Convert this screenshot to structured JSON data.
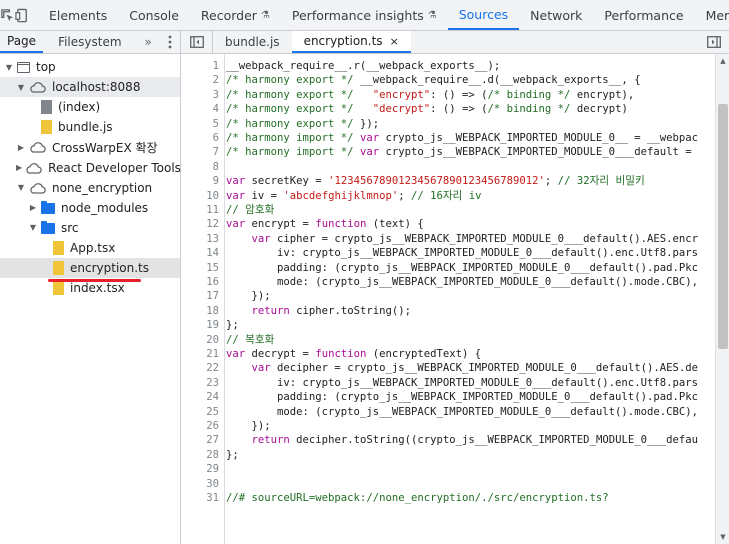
{
  "top_tabs": [
    {
      "label": "Elements",
      "active": false
    },
    {
      "label": "Console",
      "active": false
    },
    {
      "label": "Recorder",
      "active": false,
      "flask": true
    },
    {
      "label": "Performance insights",
      "active": false,
      "flask": true
    },
    {
      "label": "Sources",
      "active": true
    },
    {
      "label": "Network",
      "active": false
    },
    {
      "label": "Performance",
      "active": false
    },
    {
      "label": "Memor",
      "active": false
    }
  ],
  "navigator": {
    "tabs": [
      "Page",
      "Filesystem"
    ],
    "more": "»",
    "tree": [
      {
        "label": "top",
        "depth": 0,
        "icon": "frame",
        "twisty": "▼"
      },
      {
        "label": "localhost:8088",
        "depth": 1,
        "icon": "cloud",
        "twisty": "▼",
        "highlight": "light"
      },
      {
        "label": "(index)",
        "depth": 2,
        "icon": "file-gray",
        "twisty": ""
      },
      {
        "label": "bundle.js",
        "depth": 2,
        "icon": "file-yellow",
        "twisty": ""
      },
      {
        "label": "CrossWarpEX 확장",
        "depth": 1,
        "icon": "cloud",
        "twisty": "▶"
      },
      {
        "label": "React Developer Tools",
        "depth": 1,
        "icon": "cloud",
        "twisty": "▶"
      },
      {
        "label": "none_encryption",
        "depth": 1,
        "icon": "cloud",
        "twisty": "▼"
      },
      {
        "label": "node_modules",
        "depth": 2,
        "icon": "folder",
        "twisty": "▶"
      },
      {
        "label": "src",
        "depth": 2,
        "icon": "folder",
        "twisty": "▼"
      },
      {
        "label": "App.tsx",
        "depth": 3,
        "icon": "file-yellow",
        "twisty": ""
      },
      {
        "label": "encryption.ts",
        "depth": 3,
        "icon": "file-yellow",
        "twisty": "",
        "highlight": "hover"
      },
      {
        "label": "index.tsx",
        "depth": 3,
        "icon": "file-yellow",
        "twisty": ""
      }
    ]
  },
  "editor": {
    "tabs": [
      {
        "label": "bundle.js",
        "active": false
      },
      {
        "label": "encryption.ts",
        "active": true,
        "close": "×"
      }
    ],
    "lines": [
      [
        [
          "",
          "__webpack_require__.r(__webpack_exports__);"
        ]
      ],
      [
        [
          "c-cmt",
          "/* harmony export */ "
        ],
        [
          "",
          "__webpack_require__.d(__webpack_exports__, {"
        ]
      ],
      [
        [
          "c-cmt",
          "/* harmony export */   "
        ],
        [
          "c-str",
          "\"encrypt\""
        ],
        [
          "",
          ": () => ("
        ],
        [
          "c-cmt",
          "/* binding */"
        ],
        [
          "",
          " encrypt),"
        ]
      ],
      [
        [
          "c-cmt",
          "/* harmony export */   "
        ],
        [
          "c-str",
          "\"decrypt\""
        ],
        [
          "",
          ": () => ("
        ],
        [
          "c-cmt",
          "/* binding */"
        ],
        [
          "",
          " decrypt)"
        ]
      ],
      [
        [
          "c-cmt",
          "/* harmony export */ "
        ],
        [
          "",
          "});"
        ]
      ],
      [
        [
          "c-cmt",
          "/* harmony import */ "
        ],
        [
          "c-kw",
          "var"
        ],
        [
          "",
          " crypto_js__WEBPACK_IMPORTED_MODULE_0__ = __webpac"
        ]
      ],
      [
        [
          "c-cmt",
          "/* harmony import */ "
        ],
        [
          "c-kw",
          "var"
        ],
        [
          "",
          " crypto_js__WEBPACK_IMPORTED_MODULE_0___default = "
        ]
      ],
      [
        [
          "",
          ""
        ]
      ],
      [
        [
          "c-kw",
          "var"
        ],
        [
          "",
          " secretKey = "
        ],
        [
          "c-str",
          "'12345678901234567890123456789012'"
        ],
        [
          "",
          "; "
        ],
        [
          "c-cmt",
          "// 32자리 비밀키"
        ]
      ],
      [
        [
          "c-kw",
          "var"
        ],
        [
          "",
          " iv = "
        ],
        [
          "c-str",
          "'abcdefghijklmnop'"
        ],
        [
          "",
          "; "
        ],
        [
          "c-cmt",
          "// 16자리 iv"
        ]
      ],
      [
        [
          "c-cmt",
          "// 암호화"
        ]
      ],
      [
        [
          "c-kw",
          "var"
        ],
        [
          "",
          " encrypt = "
        ],
        [
          "c-kw",
          "function"
        ],
        [
          "",
          " (text) {"
        ]
      ],
      [
        [
          "",
          "    "
        ],
        [
          "c-kw",
          "var"
        ],
        [
          "",
          " cipher = crypto_js__WEBPACK_IMPORTED_MODULE_0___default().AES.encr"
        ]
      ],
      [
        [
          "",
          "        iv: crypto_js__WEBPACK_IMPORTED_MODULE_0___default().enc.Utf8.pars"
        ]
      ],
      [
        [
          "",
          "        padding: (crypto_js__WEBPACK_IMPORTED_MODULE_0___default().pad.Pkc"
        ]
      ],
      [
        [
          "",
          "        mode: (crypto_js__WEBPACK_IMPORTED_MODULE_0___default().mode.CBC),"
        ]
      ],
      [
        [
          "",
          "    });"
        ]
      ],
      [
        [
          "",
          "    "
        ],
        [
          "c-kw",
          "return"
        ],
        [
          "",
          " cipher.toString();"
        ]
      ],
      [
        [
          "",
          "};"
        ]
      ],
      [
        [
          "c-cmt",
          "// 복호화"
        ]
      ],
      [
        [
          "c-kw",
          "var"
        ],
        [
          "",
          " decrypt = "
        ],
        [
          "c-kw",
          "function"
        ],
        [
          "",
          " (encryptedText) {"
        ]
      ],
      [
        [
          "",
          "    "
        ],
        [
          "c-kw",
          "var"
        ],
        [
          "",
          " decipher = crypto_js__WEBPACK_IMPORTED_MODULE_0___default().AES.de"
        ]
      ],
      [
        [
          "",
          "        iv: crypto_js__WEBPACK_IMPORTED_MODULE_0___default().enc.Utf8.pars"
        ]
      ],
      [
        [
          "",
          "        padding: (crypto_js__WEBPACK_IMPORTED_MODULE_0___default().pad.Pkc"
        ]
      ],
      [
        [
          "",
          "        mode: (crypto_js__WEBPACK_IMPORTED_MODULE_0___default().mode.CBC),"
        ]
      ],
      [
        [
          "",
          "    });"
        ]
      ],
      [
        [
          "",
          "    "
        ],
        [
          "c-kw",
          "return"
        ],
        [
          "",
          " decipher.toString((crypto_js__WEBPACK_IMPORTED_MODULE_0___defau"
        ]
      ],
      [
        [
          "",
          "};"
        ]
      ],
      [
        [
          "",
          ""
        ]
      ],
      [
        [
          "",
          ""
        ]
      ],
      [
        [
          "c-cmt",
          "//# sourceURL=webpack://none_encryption/./src/encryption.ts?"
        ]
      ]
    ]
  },
  "colors": {
    "accent": "#1a73e8",
    "annotation": "#e8202a"
  }
}
